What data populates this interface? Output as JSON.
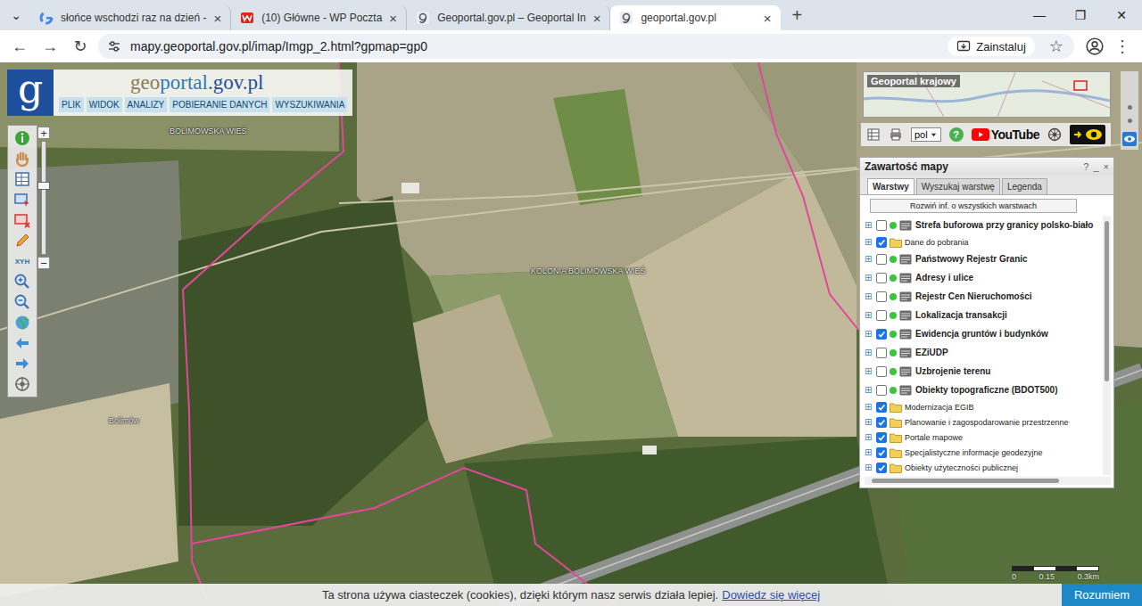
{
  "browser": {
    "tab_menu": "⌄",
    "tabs": [
      {
        "label": "słońce wschodzi raz na dzień -",
        "selected": false,
        "close": "×"
      },
      {
        "label": "(10) Główne - WP Poczta",
        "selected": false,
        "close": "×"
      },
      {
        "label": "Geoportal.gov.pl – Geoportal In",
        "selected": false,
        "close": "×"
      },
      {
        "label": "geoportal.gov.pl",
        "selected": true,
        "close": "×"
      }
    ],
    "new_tab": "+",
    "window_controls": [
      "—",
      "❐",
      "✕"
    ],
    "nav": [
      "←",
      "→",
      "↻"
    ],
    "url": "mapy.geoportal.gov.pl/imap/Imgp_2.html?gpmap=gp0",
    "install": "Zainstaluj",
    "bookmark": "☆",
    "menu": "⋮"
  },
  "app": {
    "logo": {
      "mark": "g",
      "name": [
        "geo",
        "portal",
        ".gov.pl"
      ]
    },
    "menu": [
      "PLIK",
      "WIDOK",
      "ANALIZY",
      "POBIERANIE DANYCH",
      "WYSZUKIWANIA"
    ],
    "tools": {
      "coordinates": "XYH"
    },
    "zoom": {
      "plus": "+",
      "minus": "−",
      "level": 0.6
    },
    "map_labels": [
      "BOLIMOWSKA WIEŚ",
      "KOLONIA BOLIMOWSKA WIEŚ",
      "Bolimów"
    ],
    "minimap": {
      "title": "Geoportal krajowy"
    },
    "toolbar": {
      "language": "pol",
      "help": "?",
      "video": "YouTube"
    },
    "layers_panel": {
      "title": "Zawartość mapy",
      "controls": [
        "?",
        "_",
        "×"
      ],
      "tabs": [
        {
          "label": "Warstwy",
          "selected": true
        },
        {
          "label": "Wyszukaj warstwę",
          "selected": false
        },
        {
          "label": "Legenda",
          "selected": false
        }
      ],
      "expand_all": "Rozwiń inf. o wszystkich warstwach",
      "expander": "⊞",
      "layers": [
        {
          "label": "Strefa buforowa przy granicy polsko-biało",
          "kind": "service",
          "checked": false
        },
        {
          "label": "Dane do pobrania",
          "kind": "folder",
          "checked": true
        },
        {
          "label": "Państwowy Rejestr Granic",
          "kind": "service",
          "checked": false
        },
        {
          "label": "Adresy i ulice",
          "kind": "service",
          "checked": false
        },
        {
          "label": "Rejestr Cen Nieruchomości",
          "kind": "service",
          "checked": false
        },
        {
          "label": "Lokalizacja transakcji",
          "kind": "service",
          "checked": false
        },
        {
          "label": "Ewidencja gruntów i budynków",
          "kind": "service",
          "checked": true
        },
        {
          "label": "EZiUDP",
          "kind": "service",
          "checked": false
        },
        {
          "label": "Uzbrojenie terenu",
          "kind": "service",
          "checked": false
        },
        {
          "label": "Obiekty topograficzne (BDOT500)",
          "kind": "service",
          "checked": false
        },
        {
          "label": "Modernizacja EGIB",
          "kind": "folder",
          "checked": true
        },
        {
          "label": "Planowanie i zagospodarowanie przestrzenne",
          "kind": "folder",
          "checked": true
        },
        {
          "label": "Portale mapowe",
          "kind": "folder",
          "checked": true
        },
        {
          "label": "Specjalistyczne informacje geodezyjne",
          "kind": "folder",
          "checked": true
        },
        {
          "label": "Obiekty użyteczności publicznej",
          "kind": "folder",
          "checked": true
        }
      ]
    },
    "scale": {
      "labels": [
        "0",
        "0.15",
        "0.3km"
      ]
    },
    "cookie": {
      "text": "Ta strona używa ciasteczek (cookies), dzięki którym nasz serwis działa lepiej.",
      "link": "Dowiedz się więcej",
      "button": "Rozumiem"
    }
  }
}
